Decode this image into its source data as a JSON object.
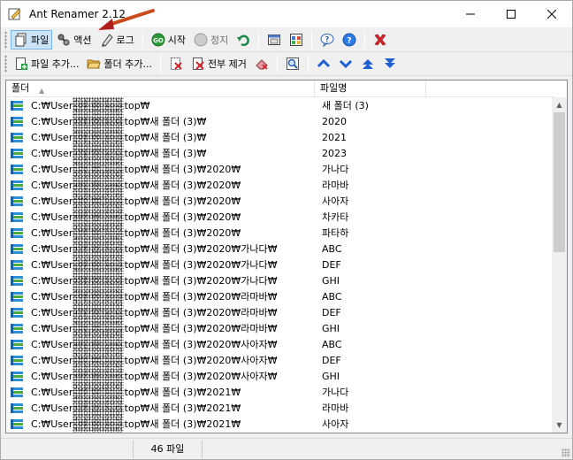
{
  "window": {
    "title": "Ant Renamer 2.12",
    "minimize": "—",
    "maximize": "☐",
    "close": "✕"
  },
  "toolbar1": {
    "files_tab": "파일",
    "actions_tab": "액션",
    "log_tab": "로그",
    "start": "시작",
    "stop": "정지"
  },
  "toolbar2": {
    "add_files": "파일 추가...",
    "add_folders": "폴더 추가...",
    "remove_all": "전부 제거"
  },
  "list": {
    "col_folder": "폴더",
    "col_name": "파일명",
    "rows": [
      {
        "folder": "C:₩Users₩       ₩Desktop₩",
        "name": "새 폴더 (3)"
      },
      {
        "folder": "C:₩Users₩       ₩Desktop₩새 폴더 (3)₩",
        "name": "2020"
      },
      {
        "folder": "C:₩Users₩       ₩Desktop₩새 폴더 (3)₩",
        "name": "2021"
      },
      {
        "folder": "C:₩Users₩       ₩Desktop₩새 폴더 (3)₩",
        "name": "2023"
      },
      {
        "folder": "C:₩Users₩       ₩Desktop₩새 폴더 (3)₩2020₩",
        "name": "가나다"
      },
      {
        "folder": "C:₩Users₩       ₩Desktop₩새 폴더 (3)₩2020₩",
        "name": "라마바"
      },
      {
        "folder": "C:₩Users₩       ₩Desktop₩새 폴더 (3)₩2020₩",
        "name": "사아자"
      },
      {
        "folder": "C:₩Users₩       ₩Desktop₩새 폴더 (3)₩2020₩",
        "name": "차카타"
      },
      {
        "folder": "C:₩Users₩       ₩Desktop₩새 폴더 (3)₩2020₩",
        "name": "파타하"
      },
      {
        "folder": "C:₩Users₩       ₩Desktop₩새 폴더 (3)₩2020₩가나다₩",
        "name": "ABC"
      },
      {
        "folder": "C:₩Users₩       ₩Desktop₩새 폴더 (3)₩2020₩가나다₩",
        "name": "DEF"
      },
      {
        "folder": "C:₩Users₩       ₩Desktop₩새 폴더 (3)₩2020₩가나다₩",
        "name": "GHI"
      },
      {
        "folder": "C:₩Users₩       ₩Desktop₩새 폴더 (3)₩2020₩라마바₩",
        "name": "ABC"
      },
      {
        "folder": "C:₩Users₩       ₩Desktop₩새 폴더 (3)₩2020₩라마바₩",
        "name": "DEF"
      },
      {
        "folder": "C:₩Users₩       ₩Desktop₩새 폴더 (3)₩2020₩라마바₩",
        "name": "GHI"
      },
      {
        "folder": "C:₩Users₩       ₩Desktop₩새 폴더 (3)₩2020₩사아자₩",
        "name": "ABC"
      },
      {
        "folder": "C:₩Users₩       ₩Desktop₩새 폴더 (3)₩2020₩사아자₩",
        "name": "DEF"
      },
      {
        "folder": "C:₩Users₩       ₩Desktop₩새 폴더 (3)₩2020₩사아자₩",
        "name": "GHI"
      },
      {
        "folder": "C:₩Users₩       ₩Desktop₩새 폴더 (3)₩2021₩",
        "name": "가나다"
      },
      {
        "folder": "C:₩Users₩       ₩Desktop₩새 폴더 (3)₩2021₩",
        "name": "라마바"
      },
      {
        "folder": "C:₩Users₩       ₩Desktop₩새 폴더 (3)₩2021₩",
        "name": "사아자"
      }
    ]
  },
  "status": {
    "file_count": "46 파일"
  },
  "colors": {
    "accent": "#cce4f7",
    "arrow": "#c0392b"
  }
}
